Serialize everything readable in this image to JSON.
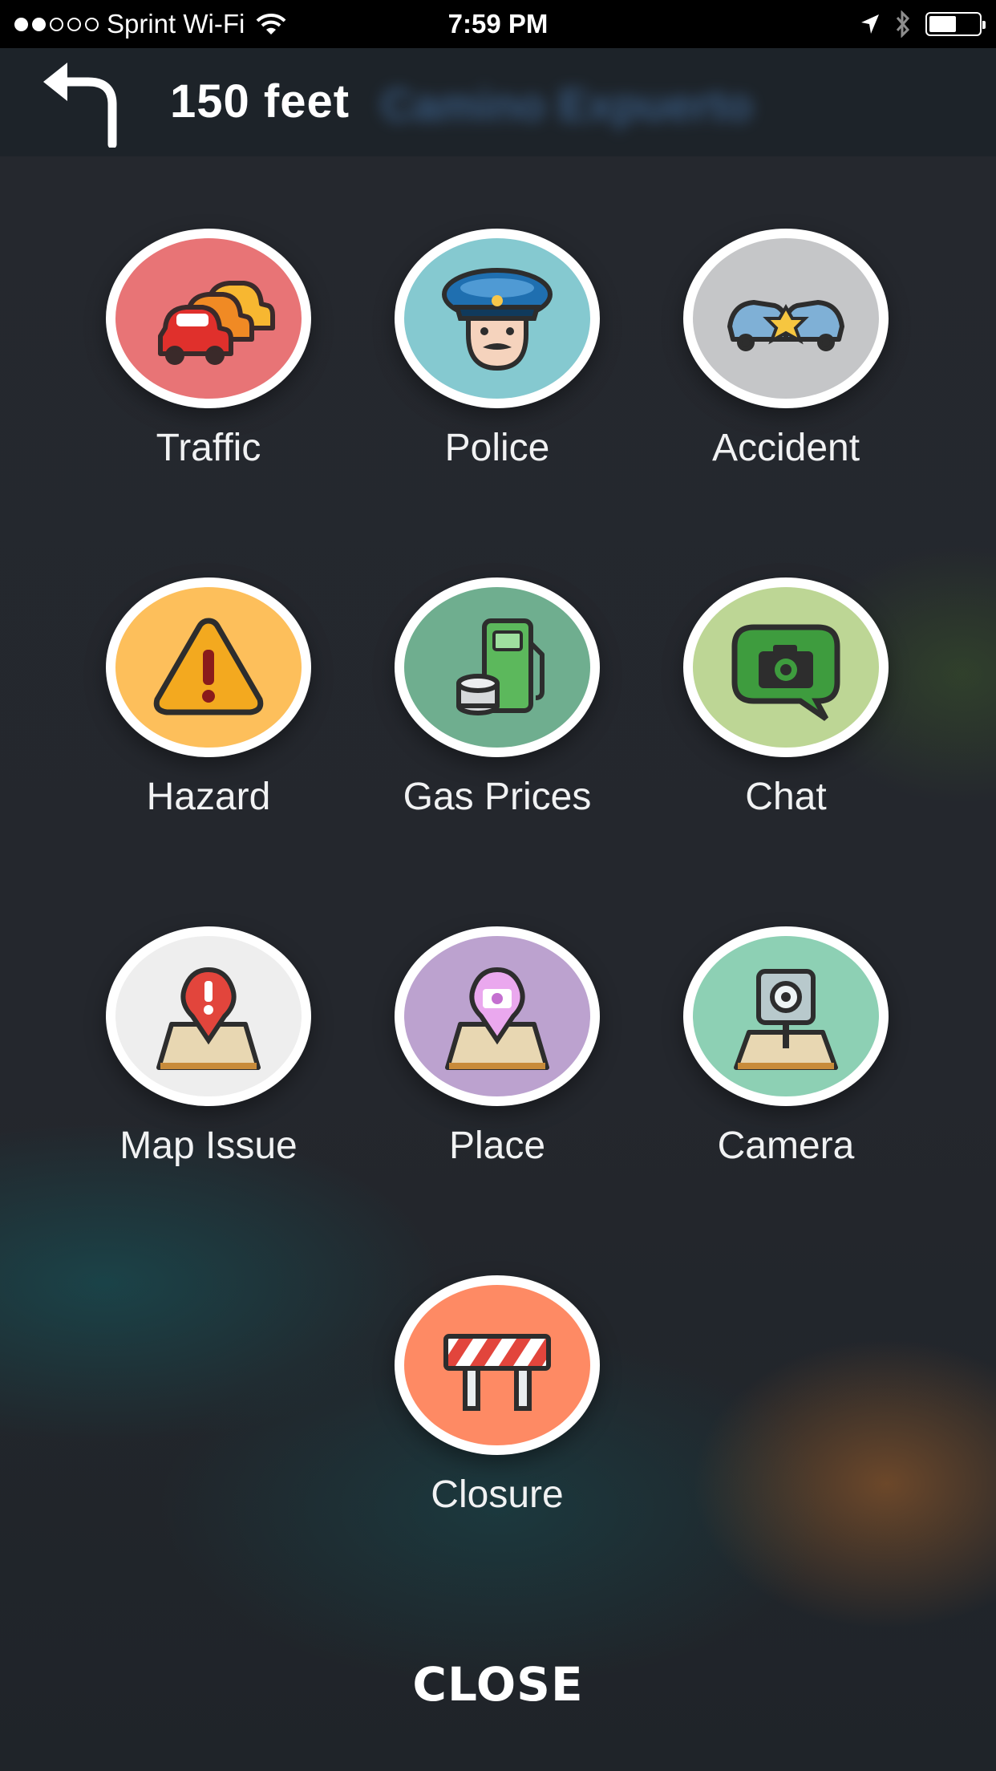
{
  "status_bar": {
    "signal_dots": [
      "on",
      "on",
      "off",
      "off",
      "off"
    ],
    "carrier": "Sprint Wi-Fi",
    "time": "7:59 PM",
    "icons": [
      "wifi-icon",
      "location-arrow-icon",
      "bluetooth-icon",
      "battery-icon"
    ],
    "battery_level": 0.55
  },
  "navigation": {
    "turn_icon": "turn-left-arrow-icon",
    "distance": "150 feet",
    "street_blurred": "Camino Expuerto"
  },
  "report_options": [
    {
      "label": "Traffic",
      "icon": "traffic-cars-icon",
      "color": "#e87476"
    },
    {
      "label": "Police",
      "icon": "police-officer-icon",
      "color": "#85c9d0"
    },
    {
      "label": "Accident",
      "icon": "car-accident-icon",
      "color": "#c5c6c8"
    },
    {
      "label": "Hazard",
      "icon": "warning-triangle-icon",
      "color": "#fdbf5b"
    },
    {
      "label": "Gas Prices",
      "icon": "gas-pump-icon",
      "color": "#6fae8f"
    },
    {
      "label": "Chat",
      "icon": "camera-chat-bubble-icon",
      "color": "#bdd695"
    },
    {
      "label": "Map Issue",
      "icon": "map-issue-pin-icon",
      "color": "#eeeeee"
    },
    {
      "label": "Place",
      "icon": "place-camera-pin-icon",
      "color": "#bca2cf"
    },
    {
      "label": "Camera",
      "icon": "speed-camera-icon",
      "color": "#8dd0b4"
    },
    {
      "label": "Closure",
      "icon": "road-closure-barrier-icon",
      "color": "#fe8a64"
    }
  ],
  "close_label": "CLOSE"
}
